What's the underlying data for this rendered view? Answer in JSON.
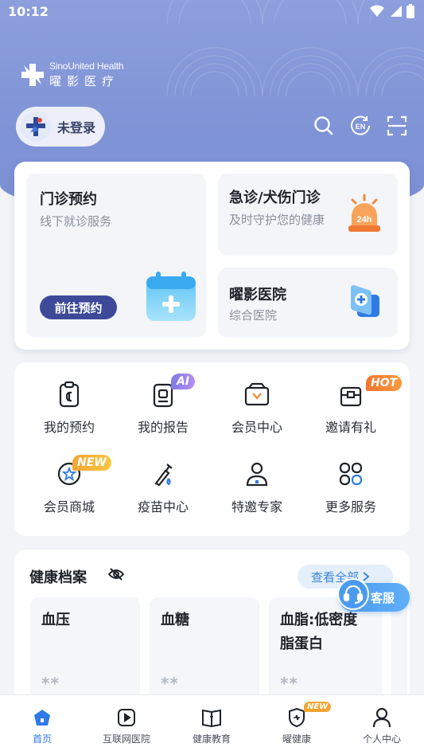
{
  "status_bar": {
    "time": "10:12"
  },
  "brand": {
    "name_en": "SinoUnited Health",
    "name_cn": "曜影医疗",
    "logo_icon": "sinounited-cross-logo"
  },
  "user": {
    "login_label": "未登录",
    "avatar_icon": "user-avatar-icon"
  },
  "top_actions": [
    {
      "icon": "search-icon"
    },
    {
      "icon": "language-en-icon",
      "text": "EN"
    },
    {
      "icon": "scan-icon"
    }
  ],
  "services": {
    "appointment": {
      "title": "门诊预约",
      "subtitle": "线下就诊服务",
      "button": "前往预约",
      "icon": "calendar-plus-icon"
    },
    "emergency": {
      "title": "急诊/犬伤门诊",
      "subtitle": "及时守护您的健康",
      "icon": "alarm-24h-icon",
      "icon_text": "24h"
    },
    "hospital": {
      "title": "曜影医院",
      "subtitle": "综合医院",
      "icon": "hospital-card-icon"
    }
  },
  "grid": [
    {
      "label": "我的预约",
      "icon": "clipboard-icon"
    },
    {
      "label": "我的报告",
      "icon": "report-icon",
      "badge": "AI"
    },
    {
      "label": "会员中心",
      "icon": "member-box-icon"
    },
    {
      "label": "邀请有礼",
      "icon": "gift-icon",
      "badge": "HOT"
    },
    {
      "label": "会员商城",
      "icon": "star-shop-icon",
      "badge": "NEW"
    },
    {
      "label": "疫苗中心",
      "icon": "vaccine-icon"
    },
    {
      "label": "特邀专家",
      "icon": "doctor-icon"
    },
    {
      "label": "更多服务",
      "icon": "more-grid-icon"
    }
  ],
  "health": {
    "title": "健康档案",
    "view_all": "查看全部",
    "metrics": [
      {
        "title": "血压",
        "value": "**"
      },
      {
        "title": "血糖",
        "value": "**"
      },
      {
        "title": "血脂:低密度脂蛋白",
        "value": "**"
      }
    ]
  },
  "customer_service": {
    "label": "客服",
    "icon": "headset-icon"
  },
  "tabs": [
    {
      "label": "首页",
      "icon": "home-icon",
      "active": true
    },
    {
      "label": "互联网医院",
      "icon": "play-video-icon"
    },
    {
      "label": "健康教育",
      "icon": "book-icon"
    },
    {
      "label": "曜健康",
      "icon": "shield-health-icon",
      "badge": "NEW"
    },
    {
      "label": "个人中心",
      "icon": "person-icon"
    }
  ],
  "colors": {
    "hero": "#8d9fdc",
    "primary_button": "#3e4a99",
    "accent_blue": "#2f7be6",
    "hot": "#f5742f",
    "new": "#f3a531"
  }
}
